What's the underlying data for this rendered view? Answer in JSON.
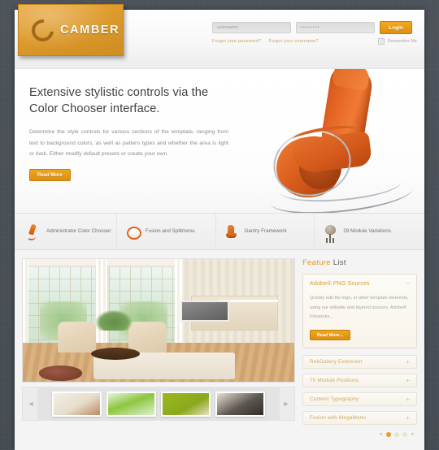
{
  "brand": {
    "name": "CAMBER",
    "logo_icon": "camber-c-logo-icon",
    "accent": "#e09a20",
    "panel": "#dd9a2c"
  },
  "login": {
    "username_placeholder": "username",
    "password_placeholder": "••••••••",
    "submit_label": "Login",
    "forgot_password": "Forgot your password?",
    "forgot_username": "Forgot your username?",
    "remember_label": "Remember Me"
  },
  "hero": {
    "title": "Extensive stylistic controls via the Color Chooser interface.",
    "body": "Determine the style controls for various sections of the template, ranging from text to background colors, as well as pattern types and whether the area is light or dark. Either modify default presets or create your own.",
    "cta_label": "Read More",
    "image_alt": "orange-leather-rocking-chair"
  },
  "features": [
    {
      "label": "Administrator Color Chooser",
      "icon": "paintbrush-icon"
    },
    {
      "label": "Fusion and Splitmenu",
      "icon": "ring-icon"
    },
    {
      "label": "Gantry Framework",
      "icon": "chair-icon"
    },
    {
      "label": "29 Module Variations",
      "icon": "lamp-icon"
    }
  ],
  "gallery": {
    "main_alt": "modern-living-room-interior",
    "prev_label": "◄",
    "next_label": "►",
    "thumbs": [
      {
        "alt": "living-room-beige-thumbnail"
      },
      {
        "alt": "green-sofa-room-thumbnail"
      },
      {
        "alt": "olive-green-wall-sofa-thumbnail"
      },
      {
        "alt": "dark-leather-sofa-thumbnail"
      }
    ]
  },
  "sidebar": {
    "heading_accent": "Feature",
    "heading_rest": "List",
    "open_item": {
      "title": "Adobe® PNG Sources",
      "toggle": "–",
      "body": "Quickly edit the logo, or other template elements, using our editable and layered sources. Adobe® Fireworks...",
      "cta_label": "Read More..."
    },
    "closed_items": [
      {
        "title": "RokGallery Extension",
        "toggle": "+"
      },
      {
        "title": "70 Module Positions",
        "toggle": "+"
      },
      {
        "title": "Content Typography",
        "toggle": "+"
      },
      {
        "title": "Fusion with MegaMenu",
        "toggle": "+"
      }
    ],
    "pager": {
      "prev": "◄",
      "next": "►",
      "dots": 3,
      "active": 0
    }
  }
}
